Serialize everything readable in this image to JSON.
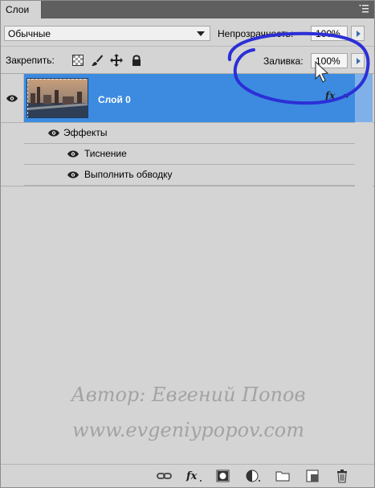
{
  "panel": {
    "tab_label": "Слои",
    "menu_icon": "panel-menu-icon"
  },
  "blend": {
    "mode": "Обычные",
    "opacity_label": "Непрозрачность:",
    "opacity_value": "100%"
  },
  "lock": {
    "label": "Закрепить:",
    "icons": [
      "lock-transparent-icon",
      "lock-brush-icon",
      "lock-move-icon",
      "lock-all-icon"
    ]
  },
  "fill": {
    "label": "Заливка:",
    "value": "100%"
  },
  "layers": [
    {
      "name": "Слой 0",
      "effects_label": "Эффекты",
      "effects": [
        "Тиснение",
        "Выполнить обводку"
      ]
    }
  ],
  "watermark": {
    "line1": "Автор: Евгений Попов",
    "line2": "www.evgeniypopov.com"
  },
  "bottom_icons": [
    "link-layers-icon",
    "fx-icon",
    "mask-icon",
    "adjustment-icon",
    "group-folder-icon",
    "new-layer-icon",
    "trash-icon"
  ],
  "colors": {
    "selection": "#3c8be0",
    "annotation": "#2c2fd6"
  }
}
